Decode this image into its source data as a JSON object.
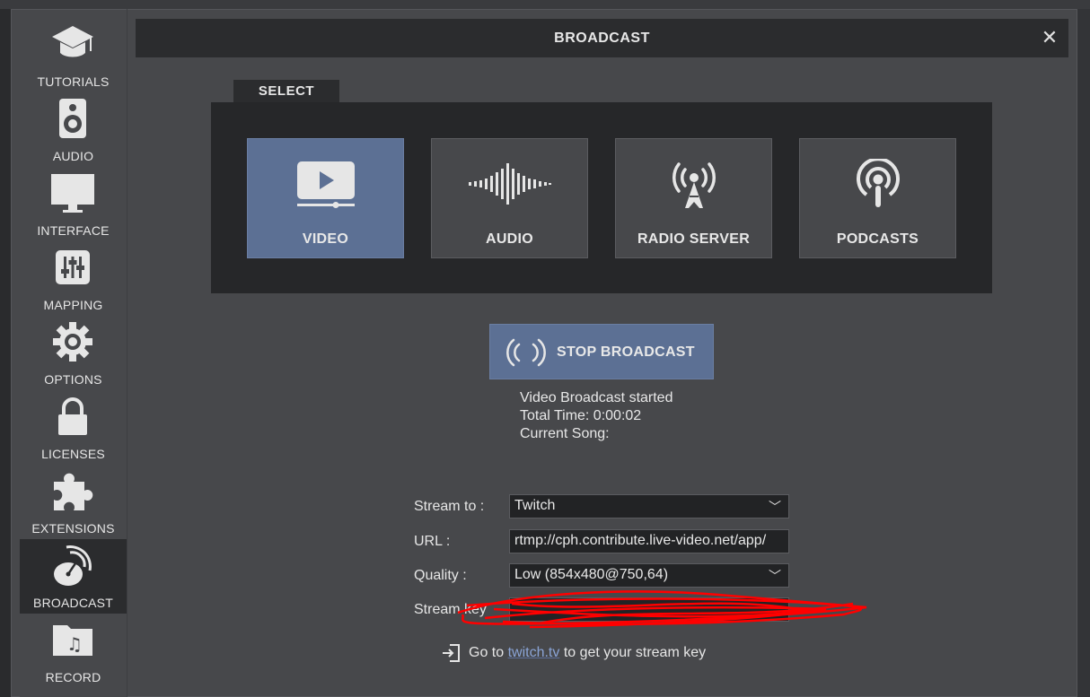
{
  "window_title": "BROADCAST",
  "sidebar": {
    "items": [
      {
        "label": "TUTORIALS",
        "icon": "graduation-cap-icon"
      },
      {
        "label": "AUDIO",
        "icon": "speaker-icon"
      },
      {
        "label": "INTERFACE",
        "icon": "monitor-icon"
      },
      {
        "label": "MAPPING",
        "icon": "sliders-icon"
      },
      {
        "label": "OPTIONS",
        "icon": "gear-icon"
      },
      {
        "label": "LICENSES",
        "icon": "lock-icon"
      },
      {
        "label": "EXTENSIONS",
        "icon": "puzzle-icon"
      },
      {
        "label": "BROADCAST",
        "icon": "satellite-dish-icon",
        "active": true
      },
      {
        "label": "RECORD",
        "icon": "music-folder-icon"
      }
    ]
  },
  "select": {
    "tab_label": "SELECT",
    "options": [
      {
        "label": "VIDEO",
        "icon": "video-play-icon",
        "active": true
      },
      {
        "label": "AUDIO",
        "icon": "waveform-icon"
      },
      {
        "label": "RADIO SERVER",
        "icon": "radio-tower-icon"
      },
      {
        "label": "PODCASTS",
        "icon": "podcast-icon"
      }
    ]
  },
  "broadcast": {
    "button_label": "STOP BROADCAST",
    "status_line": "Video Broadcast started",
    "total_time": "Total Time: 0:00:02",
    "current_song": "Current Song:"
  },
  "form": {
    "stream_to_label": "Stream to :",
    "stream_to_value": "Twitch",
    "url_label": "URL :",
    "url_value": "rtmp://cph.contribute.live-video.net/app/",
    "quality_label": "Quality :",
    "quality_value": "Low (854x480@750,64)",
    "stream_key_label": "Stream key"
  },
  "help": {
    "prefix": "Go to ",
    "link": "twitch.tv",
    "suffix": " to get your stream key"
  },
  "colors": {
    "accent": "#5c7094",
    "link": "#8aa4d6",
    "redaction": "#ff0000"
  }
}
